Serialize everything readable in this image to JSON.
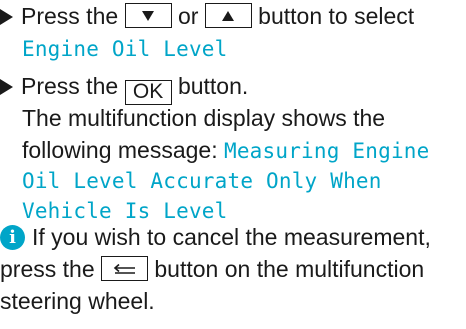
{
  "step1": {
    "press_the": "Press the",
    "or": "or",
    "button_to_select": "button to select",
    "down_key_icon": "triangle-down",
    "up_key_icon": "triangle-up",
    "menu_item": "Engine Oil Level"
  },
  "step2": {
    "press_the": "Press the",
    "ok_key": "OK",
    "button": "button.",
    "result_line1": "The multifunction display shows the",
    "result_line2_prefix": "following message:",
    "msg_part1": "Measuring Engine",
    "msg_part2": "Oil Level Accurate Only When",
    "msg_part3": "Vehicle Is Level"
  },
  "note": {
    "icon": "i",
    "line1": "If you wish to cancel the measurement,",
    "line2_prefix": "press the",
    "back_key_icon": "back-arrow",
    "line2_suffix": "button on the multifunction",
    "line3": "steering wheel."
  },
  "colors": {
    "display_text": "#00a5c8",
    "info_icon": "#00a5c8",
    "body_text": "#1a1a1a"
  }
}
